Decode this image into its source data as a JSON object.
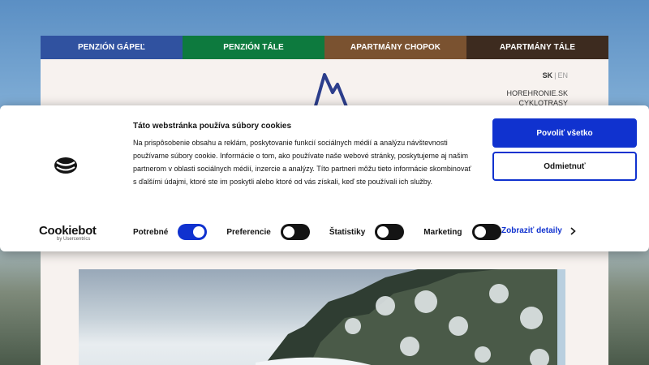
{
  "site": {
    "nav_tabs": [
      {
        "label": "PENZIÓN GÁPEĽ",
        "color": "#3052a0"
      },
      {
        "label": "PENZIÓN TÁLE",
        "color": "#0d7a3e"
      },
      {
        "label": "APARTMÁNY CHOPOK",
        "color": "#7a5230"
      },
      {
        "label": "APARTMÁNY TÁLE",
        "color": "#3d2b1f"
      }
    ],
    "lang_active": "SK",
    "lang_sep": "|",
    "lang_inactive": "EN",
    "side_links": [
      "HOREHRONIE.SK",
      "CYKLOTRASY"
    ],
    "logo_icon": "mountain-logo-icon"
  },
  "cookie": {
    "title": "Táto webstránka používa súbory cookies",
    "body": "Na prispôsobenie obsahu a reklám, poskytovanie funkcií sociálnych médií a analýzu návštevnosti používame súbory cookie. Informácie o tom, ako používate naše webové stránky, poskytujeme aj našim partnerom v oblasti sociálnych médií, inzercie a analýzy. Títo partneri môžu tieto informácie skombinovať s ďalšími údajmi, ktoré ste im poskytli alebo ktoré od vás získali, keď ste používali ich služby.",
    "brand_name": "Cookiebot",
    "brand_by": "by Usercentrics",
    "allow_all_label": "Povoliť všetko",
    "reject_label": "Odmietnuť",
    "toggles": [
      {
        "label": "Potrebné",
        "state": "on"
      },
      {
        "label": "Preferencie",
        "state": "off"
      },
      {
        "label": "Štatistiky",
        "state": "off"
      },
      {
        "label": "Marketing",
        "state": "off"
      }
    ],
    "details_label": "Zobraziť detaily",
    "accent_color": "#1032cf"
  }
}
